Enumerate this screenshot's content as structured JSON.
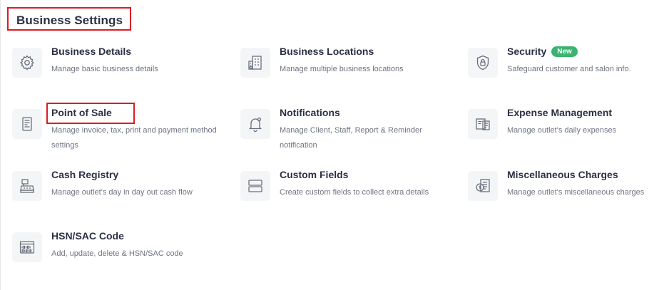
{
  "header": {
    "title": "Business Settings"
  },
  "cards": [
    {
      "title": "Business Details",
      "desc": "Manage basic business details",
      "icon": "gear-icon"
    },
    {
      "title": "Business Locations",
      "desc": "Manage multiple business locations",
      "icon": "building-icon"
    },
    {
      "title": "Security",
      "badge": "New",
      "desc": "Safeguard customer and salon info.",
      "icon": "shield-lock-icon"
    },
    {
      "title": "Point of Sale",
      "desc": "Manage invoice, tax, print and payment method settings",
      "icon": "receipt-icon"
    },
    {
      "title": "Notifications",
      "desc": "Manage Client, Staff, Report & Reminder notification",
      "icon": "bell-icon"
    },
    {
      "title": "Expense Management",
      "desc": "Manage outlet's daily expenses",
      "icon": "expense-icon"
    },
    {
      "title": "Cash Registry",
      "desc": "Manage outlet's day in day out cash flow",
      "icon": "cash-register-icon"
    },
    {
      "title": "Custom Fields",
      "desc": "Create custom fields to collect extra details",
      "icon": "fields-icon"
    },
    {
      "title": "Miscellaneous Charges",
      "desc": "Manage outlet's miscellaneous charges",
      "icon": "charges-icon"
    },
    {
      "title": "HSN/SAC Code",
      "desc": "Add, update, delete & HSN/SAC code",
      "icon": "binary-code-icon"
    }
  ],
  "colors": {
    "highlight": "#e01a22",
    "badge": "#3cb371",
    "icon_bg": "#f4f5f7"
  }
}
